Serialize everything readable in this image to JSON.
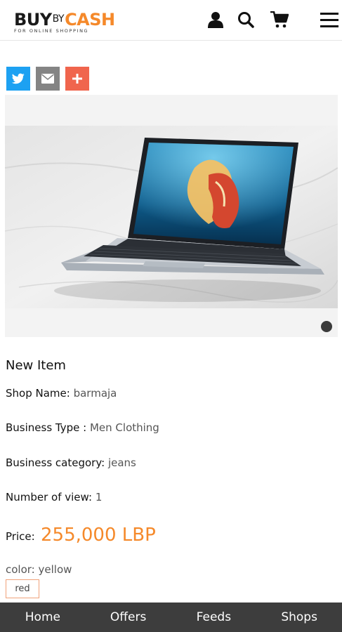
{
  "header": {
    "logo_buy": "BUY",
    "logo_by": "BY",
    "logo_cash": "CASH",
    "logo_tagline": "FOR ONLINE SHOPPING",
    "icons": [
      "user-icon",
      "search-icon",
      "cart-icon",
      "menu-icon"
    ]
  },
  "share": {
    "buttons": [
      {
        "name": "twitter",
        "color": "#1da1f2"
      },
      {
        "name": "email",
        "color": "#848484"
      },
      {
        "name": "add",
        "color": "#f0654d"
      }
    ]
  },
  "carousel": {
    "slide_count": 1,
    "active_index": 0
  },
  "product": {
    "title": "New Item",
    "shop_label": "Shop Name:",
    "shop_value": "barmaja",
    "type_label": "Business Type :",
    "type_value": "Men Clothing",
    "category_label": "Business category:",
    "category_value": "jeans",
    "views_label": "Number of view:",
    "views_value": "1",
    "price_label": "Price:",
    "price_value": "255,000 LBP",
    "color_label": "color:",
    "color_value": "yellow",
    "color_option": "red"
  },
  "bottom_nav": {
    "items": [
      "Home",
      "Offers",
      "Feeds",
      "Shops"
    ]
  },
  "colors": {
    "accent": "#f5892a",
    "nav_bg": "#3d3d3d"
  }
}
